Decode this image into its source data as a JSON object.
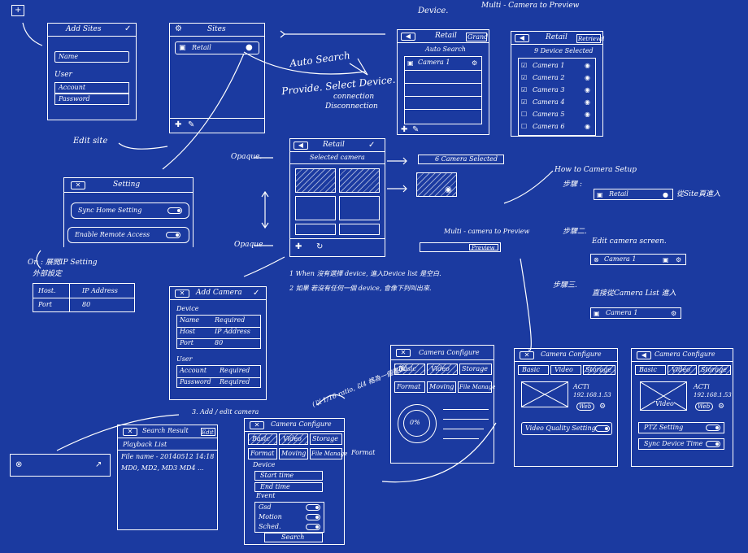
{
  "colors": {
    "background": "#1b3aa0",
    "ink": "#ffffff"
  },
  "notes": {
    "device": "Device.",
    "multi_camera_preview": "Multi - Camera to Preview",
    "auto_search": "Auto Search",
    "provide_select_device": "Provide. Select Device.",
    "connection": "connection",
    "disconnection": "Disconnection",
    "edit_site": "Edit site",
    "opaque_top": "Opaque.",
    "opaque_bottom": "Opaque",
    "how_to_camera_setup": "How to Camera Setup",
    "step1": "步驟 :",
    "step1_desc": "從Site頁進入",
    "multi_camera_preview2": "Multi - camera to Preview",
    "step2": "步驟二.",
    "edit_camera_screen": "Edit camera screen.",
    "step3": "步驟三.",
    "direct_camera_list": "直接從Camera List 進入",
    "on_ip_setting": "On : 展開IP Setting",
    "external_setting": "外部設定",
    "when_no_device": "1  When 沒有選擇 device, 進入Device list 是空白.",
    "if_has_device": "2  如果 若沒有任何一個 device, 會像下列叫出來.",
    "add_edit_camera": "3. Add / edit camera",
    "zoom_note": "(以 1/16 ratio, 以4 格為一個畫面)",
    "format_arrow": "Format"
  },
  "add_sites": {
    "title": "Add Sites",
    "name": "Name",
    "user": "User",
    "account": "Account",
    "password": "Password"
  },
  "sites": {
    "title": "Sites",
    "item": "Retail"
  },
  "retail_search": {
    "title": "Retail",
    "right_btn": "Grand",
    "subtitle": "Auto Search",
    "item": "Camera 1"
  },
  "retail_devices": {
    "title": "Retail",
    "right_btn": "Retrieval",
    "subtitle": "9 Device Selected",
    "cameras": [
      "Camera 1",
      "Camera 2",
      "Camera 3",
      "Camera 4",
      "Camera 5",
      "Camera 6"
    ]
  },
  "retail_grid": {
    "title": "Retail",
    "subtitle": "Selected camera",
    "selected_label": "6 Camera Selected",
    "preview_label": "Preview"
  },
  "setting": {
    "title": "Setting",
    "sync_home": "Sync Home Setting",
    "enable_remote": "Enable Remote Access"
  },
  "ip_table": {
    "host_label": "Host.",
    "host_value": "IP Address",
    "port_label": "Port",
    "port_value": "80"
  },
  "add_camera": {
    "title": "Add Camera",
    "device": "Device",
    "name": "Name",
    "name_value": "Required",
    "host": "Host",
    "host_value": "IP Address",
    "port": "Port",
    "port_value": "80",
    "user": "User",
    "account": "Account",
    "account_value": "Required",
    "password": "Password",
    "password_value": "Required"
  },
  "site_retail": "Retail",
  "edit_camera_row": "Camera 1",
  "camera_list_row": "Camera 1",
  "search_result": {
    "title": "Search Result",
    "edit": "Edit",
    "subtitle": "Playback List",
    "line1": "File name - 20140512 14:18",
    "line2": "MD0, MD2, MD3 MD4 ..."
  },
  "cam_cfg_storage": {
    "title": "Camera Configure",
    "tabs": [
      "Basic",
      "Video",
      "Storage"
    ],
    "subtabs": [
      "Format",
      "Moving",
      "File Manage"
    ],
    "device": "Device",
    "start_time": "Start time",
    "end_time": "End time",
    "event": "Event",
    "options": [
      "Gsd",
      "Motion",
      "Sched."
    ],
    "search": "Search"
  },
  "cam_cfg_format": {
    "title": "Camera Configure",
    "tabs": [
      "Basic",
      "Video",
      "Storage"
    ],
    "subtabs": [
      "Format",
      "Moving",
      "File Manage"
    ],
    "percent": "0%"
  },
  "cam_cfg_video": {
    "title": "Camera Configure",
    "tabs": [
      "Basic",
      "Video",
      "Storage"
    ],
    "model": "ACTi",
    "ip": "192.168.1.53",
    "web": "Web",
    "setting": "Video Quality Setting"
  },
  "cam_cfg_basic": {
    "title": "Camera Configure",
    "tabs": [
      "Basic",
      "Video",
      "Storage"
    ],
    "model": "ACTi",
    "ip": "192.168.1.53",
    "web": "Web",
    "video": "Video",
    "ptz": "PTZ Setting",
    "sync_time": "Sync Device Time"
  }
}
